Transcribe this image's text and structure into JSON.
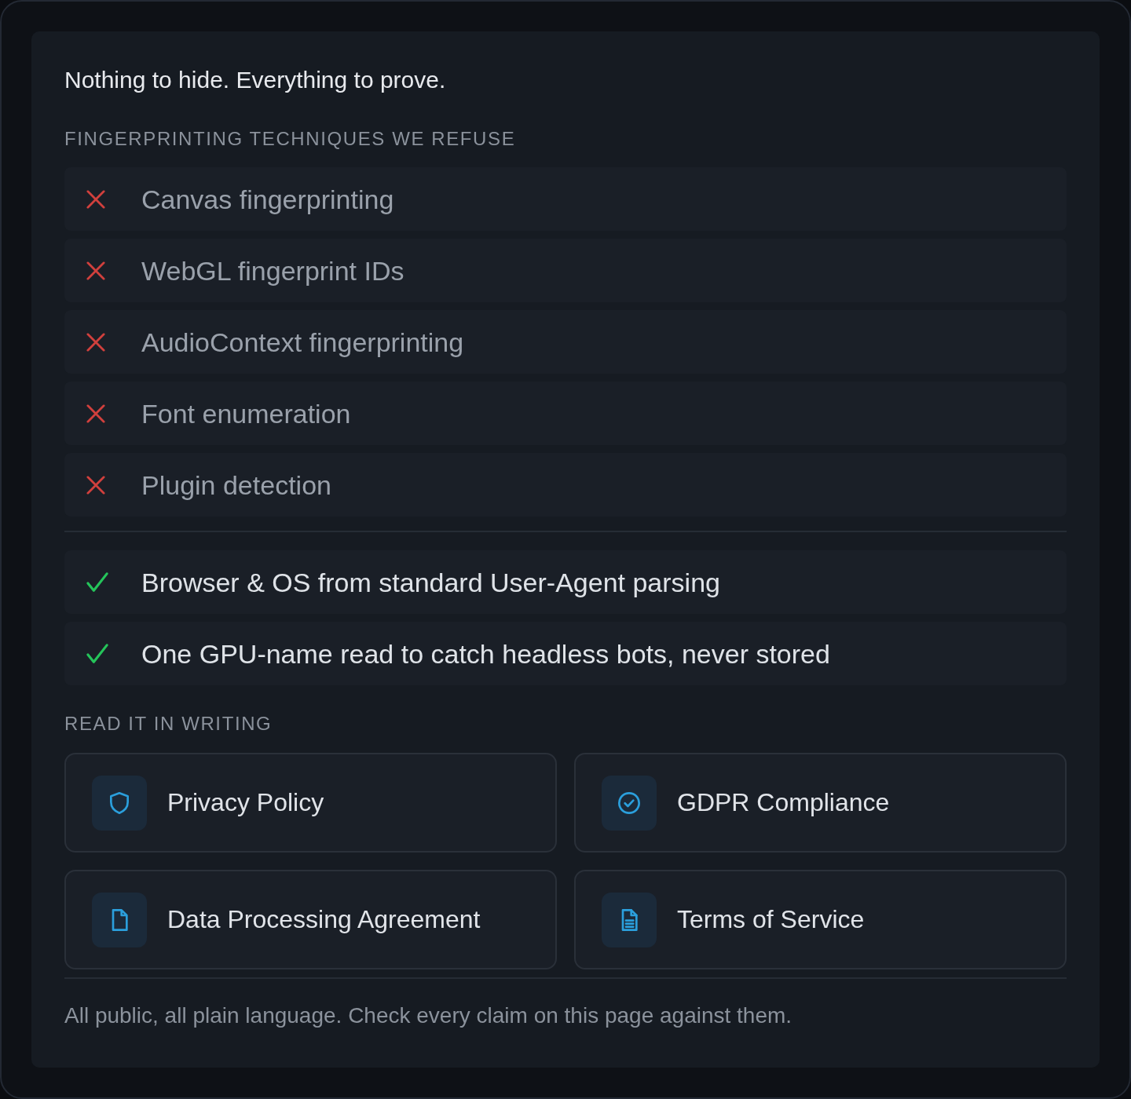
{
  "heading": "Nothing to hide. Everything to prove.",
  "techniques": {
    "label": "FINGERPRINTING TECHNIQUES WE REFUSE",
    "refused": [
      {
        "text": "Canvas fingerprinting"
      },
      {
        "text": "WebGL fingerprint IDs"
      },
      {
        "text": "AudioContext fingerprinting"
      },
      {
        "text": "Font enumeration"
      },
      {
        "text": "Plugin detection"
      }
    ],
    "allowed": [
      {
        "text": "Browser & OS from standard User‑Agent parsing"
      },
      {
        "text": "One GPU‑name read to catch headless bots, never stored"
      }
    ]
  },
  "documents": {
    "label": "READ IT IN WRITING",
    "links": [
      {
        "kind": "policy",
        "text": "Privacy Policy"
      },
      {
        "kind": "compliance",
        "text": "GDPR Compliance"
      },
      {
        "kind": "agreement",
        "text": "Data Processing Agreement"
      },
      {
        "kind": "terms",
        "text": "Terms of Service"
      }
    ]
  },
  "note": "All public, all plain language. Check every claim on this page against them."
}
